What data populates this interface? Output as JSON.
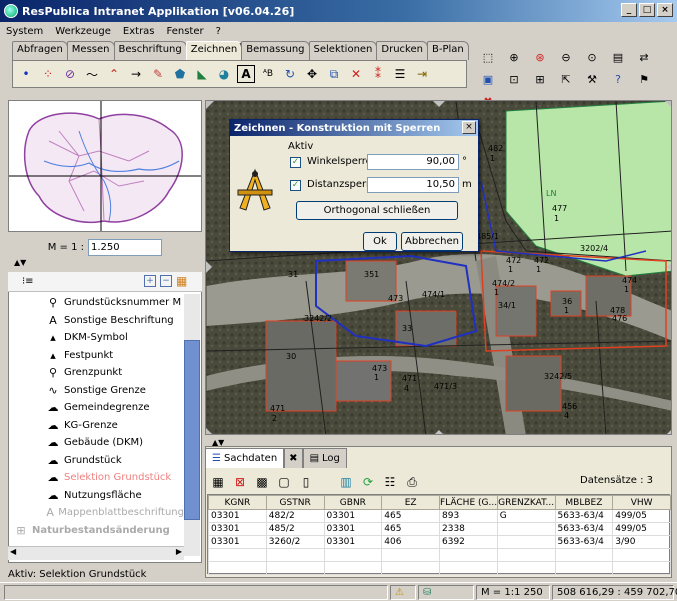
{
  "window": {
    "title": "ResPublica Intranet Applikation  [v06.04.26]"
  },
  "menu": [
    "System",
    "Werkzeuge",
    "Extras",
    "Fenster",
    "?"
  ],
  "ribbon_tabs": [
    {
      "label": "Abfragen",
      "active": false
    },
    {
      "label": "Messen",
      "active": false
    },
    {
      "label": "Beschriftung",
      "active": false
    },
    {
      "label": "Zeichnen",
      "active": true
    },
    {
      "label": "Bemassung",
      "active": false
    },
    {
      "label": "Selektionen",
      "active": false
    },
    {
      "label": "Drucken",
      "active": false
    },
    {
      "label": "B-Plan",
      "active": false
    }
  ],
  "scale": {
    "label": "M = 1 :",
    "value": "1.250"
  },
  "layers": [
    {
      "label": "Grundstücksnummer M",
      "icon": "magnifier-icon"
    },
    {
      "label": "Sonstige Beschriftung",
      "icon": "letter-a-icon"
    },
    {
      "label": "DKM-Symbol",
      "icon": "dkm-symbol-icon"
    },
    {
      "label": "Festpunkt",
      "icon": "fixpoint-icon"
    },
    {
      "label": "Grenzpunkt",
      "icon": "magnifier-icon"
    },
    {
      "label": "Sonstige Grenze",
      "icon": "line-icon"
    },
    {
      "label": "Gemeindegrenze",
      "icon": "polygon-icon"
    },
    {
      "label": "KG-Grenze",
      "icon": "polygon-icon"
    },
    {
      "label": "Gebäude (DKM)",
      "icon": "polygon-icon"
    },
    {
      "label": "Grundstück",
      "icon": "polygon-icon"
    },
    {
      "label": "Selektion Grundstück",
      "icon": "polygon-icon",
      "selected": true
    },
    {
      "label": "Nutzungsfläche",
      "icon": "polygon-icon"
    },
    {
      "label": "Mappenblattbeschriftung",
      "icon": "letter-a-icon",
      "faded": true
    },
    {
      "label": "Naturbestandsänderung",
      "icon": "expand-icon",
      "faded": true
    }
  ],
  "status_left": "Aktiv: Selektion Grundstück",
  "dialog": {
    "title": "Zeichnen - Konstruktion mit Sperren",
    "group": "Aktiv",
    "winkel_label": "Winkelsperre",
    "winkel_value": "90,00",
    "winkel_unit": "°",
    "distanz_label": "Distanzsperre",
    "distanz_value": "10,50",
    "distanz_unit": "m",
    "ortho_button": "Orthogonal schließen",
    "ok": "Ok",
    "cancel": "Abbrechen"
  },
  "map_labels": [
    "482",
    "1",
    "477",
    "1",
    "LN",
    "3202/4",
    "485/1",
    "31",
    "351",
    "474/1",
    "473",
    "34/1",
    "36",
    "1",
    "476",
    "478",
    "33",
    "3242/2",
    "30",
    "471",
    "2",
    "473",
    "1",
    "471/3",
    "471",
    "4",
    "3242/5",
    "456",
    "4",
    "472",
    "1",
    "472",
    "1",
    "474",
    "1",
    "474/2",
    "1"
  ],
  "data_tabs": [
    {
      "label": "Sachdaten",
      "active": true
    },
    {
      "label": "Log",
      "active": false
    }
  ],
  "records_label": "Datensätze : 3",
  "table": {
    "columns": [
      "KGNR",
      "GSTNR",
      "GBNR",
      "EZ",
      "FLÄCHE (G...",
      "GRENZKAT...",
      "MBLBEZ",
      "VHW"
    ],
    "rows": [
      [
        "03301",
        "482/2",
        "03301",
        "465",
        "893",
        "G",
        "5633-63/4",
        "499/05"
      ],
      [
        "03301",
        "485/2",
        "03301",
        "465",
        "2338",
        "",
        "5633-63/4",
        "499/05"
      ],
      [
        "03301",
        "3260/2",
        "03301",
        "406",
        "6392",
        "",
        "5633-63/4",
        "3/90"
      ]
    ]
  },
  "bottom": {
    "scale": "M = 1:1 250",
    "coordinates": "508 616,29 :   459 702,70"
  },
  "colors": {
    "title_start": "#0a246a",
    "title_end": "#a6caf0",
    "selection": "#f08080",
    "parcel": "#e04020",
    "meadow": "#b8e6a8"
  }
}
